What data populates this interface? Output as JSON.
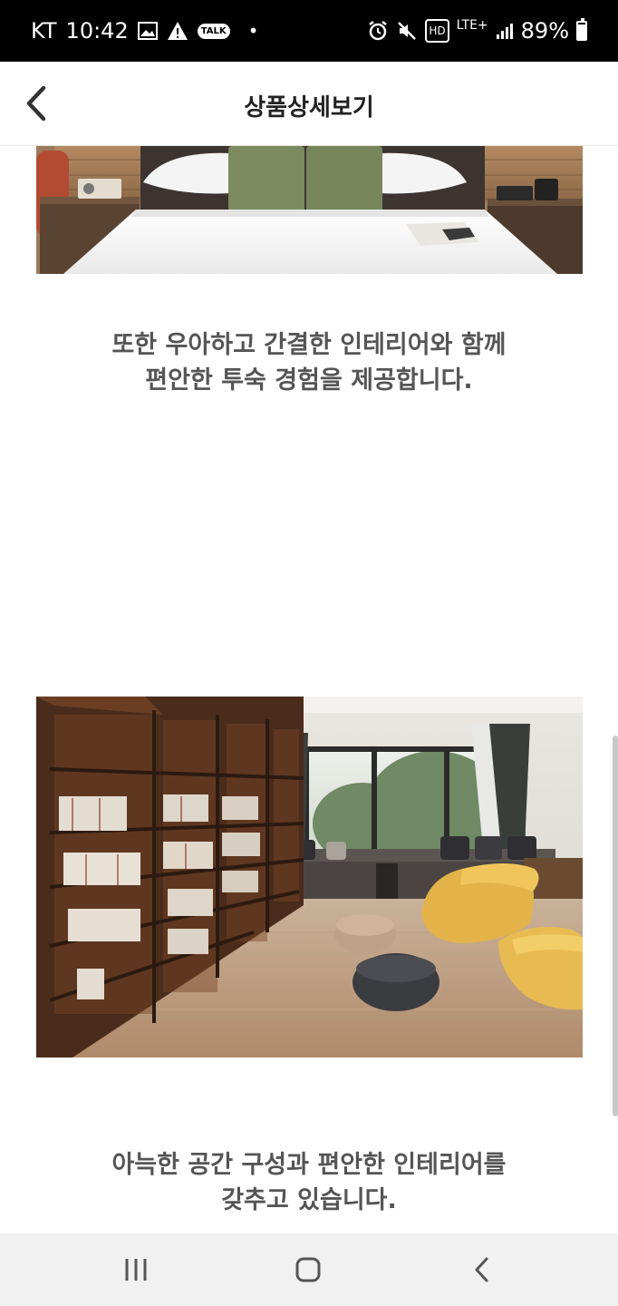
{
  "status_bar": {
    "carrier": "KT",
    "time": "10:42",
    "talk_badge": "TALK",
    "hd": "HD",
    "lte": "LTE+",
    "battery": "89%",
    "battery_level": 0.89
  },
  "header": {
    "title": "상품상세보기"
  },
  "content": {
    "caption_1": [
      "또한 우아하고 간결한 인테리어와 함께",
      "편안한 투숙 경험을 제공합니다."
    ],
    "caption_2": [
      "아늑한 공간 구성과 편안한 인테리어를",
      "갖추고 있습니다."
    ]
  },
  "icons": {
    "back": "chevron-left-icon",
    "recents": "recent-apps-icon",
    "home": "home-icon",
    "nav_back": "nav-back-icon"
  },
  "colors": {
    "status_bar_bg": "#000000",
    "caption_text": "#555555",
    "nav_bar_bg": "#f1f1f1"
  }
}
